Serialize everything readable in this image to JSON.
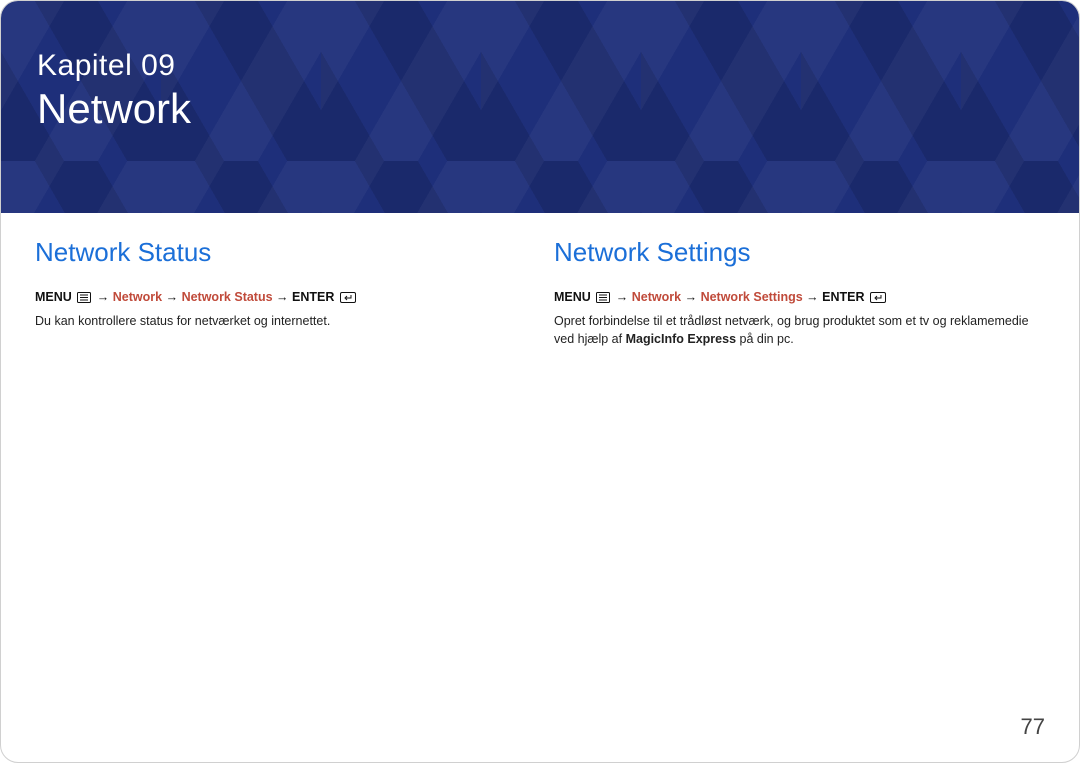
{
  "banner": {
    "chapter": "Kapitel 09",
    "title": "Network"
  },
  "left": {
    "heading": "Network Status",
    "path": {
      "menu": "MENU",
      "seg1": "Network",
      "seg2": "Network Status",
      "enter": "ENTER"
    },
    "desc": "Du kan kontrollere status for netværket og internettet."
  },
  "right": {
    "heading": "Network Settings",
    "path": {
      "menu": "MENU",
      "seg1": "Network",
      "seg2": "Network Settings",
      "enter": "ENTER"
    },
    "desc_pre": "Opret forbindelse til et trådløst netværk, og brug produktet som et tv og reklamemedie ved hjælp af ",
    "desc_bold": "MagicInfo Express",
    "desc_post": "  på din pc."
  },
  "arrow": "→",
  "pagenum": "77"
}
